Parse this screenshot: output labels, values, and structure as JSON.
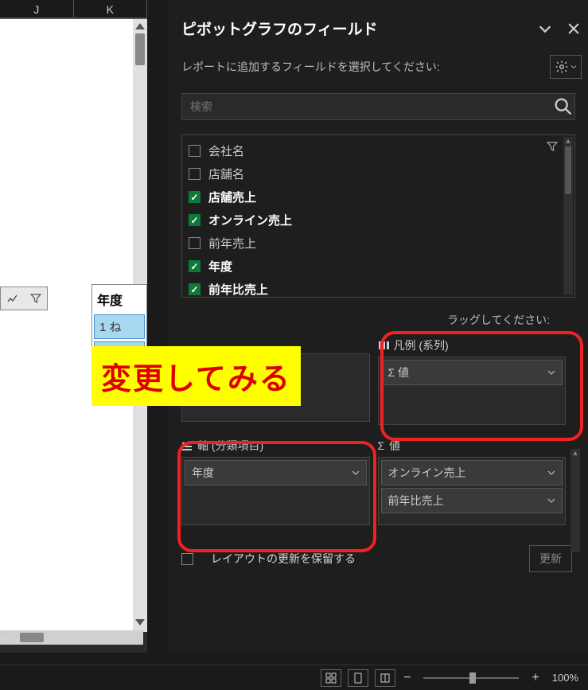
{
  "columns": {
    "j": "J",
    "k": "K"
  },
  "panel": {
    "title": "ピボットグラフのフィールド",
    "subtitle": "レポートに追加するフィールドを選択してください:",
    "search_placeholder": "検索"
  },
  "fields": [
    {
      "label": "会社名",
      "checked": false
    },
    {
      "label": "店舗名",
      "checked": false
    },
    {
      "label": "店舗売上",
      "checked": true
    },
    {
      "label": "オンライン売上",
      "checked": true
    },
    {
      "label": "前年売上",
      "checked": false
    },
    {
      "label": "年度",
      "checked": true
    },
    {
      "label": "前年比売上",
      "checked": true
    }
  ],
  "drag_text_suffix": "ラッグしてください:",
  "legend": {
    "title": "凡例 (系列)",
    "items": [
      "値"
    ],
    "sigma": "Σ"
  },
  "axis": {
    "title": "軸 (分類項目)",
    "items": [
      "年度"
    ]
  },
  "values": {
    "title": "値",
    "sigma": "Σ",
    "items": [
      "オンライン売上",
      "前年比売上"
    ]
  },
  "defer": {
    "label": "レイアウトの更新を保留する",
    "button": "更新"
  },
  "year_box": {
    "header": "年度",
    "cell1": "1 ね"
  },
  "annotation": "変更してみる",
  "zoom": {
    "value": "100%"
  }
}
